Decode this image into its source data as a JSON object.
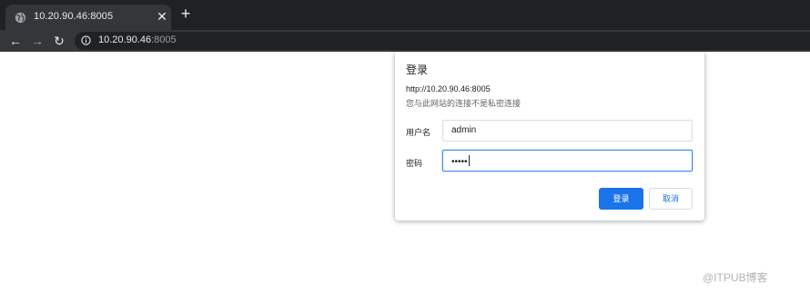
{
  "tab": {
    "title": "10.20.90.46:8005",
    "close_glyph": "✕",
    "new_tab_glyph": "+",
    "icon": "globe-icon"
  },
  "toolbar": {
    "back_glyph": "←",
    "forward_glyph": "→",
    "reload_glyph": "↻",
    "address_host": "10.20.90.46",
    "address_port": ":8005"
  },
  "dialog": {
    "title": "登录",
    "url": "http://10.20.90.46:8005",
    "note": "您与此网站的连接不是私密连接",
    "username_label": "用户名",
    "username_value": "admin",
    "password_label": "密码",
    "password_value": "•••••",
    "login_label": "登录",
    "cancel_label": "取消"
  },
  "watermark": "@ITPUB博客",
  "colors": {
    "accent": "#1a73e8",
    "chrome_dark": "#202124",
    "chrome_tab": "#35363a"
  }
}
